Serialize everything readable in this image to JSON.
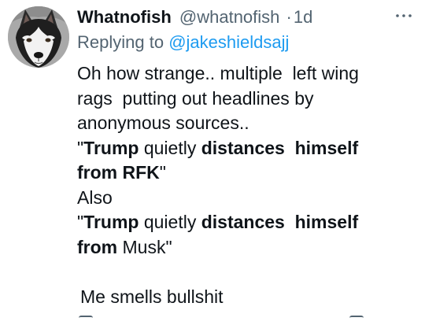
{
  "tweet": {
    "display_name": "Whatnofish",
    "handle": "@whatnofish",
    "separator": "·",
    "time": "1d",
    "more_icon": "more-horizontal-icon",
    "replying_prefix": "Replying to ",
    "replying_to": "@jakeshieldsajj",
    "lines": {
      "l1": "Oh how strange.. multiple  left wing",
      "l2": "rags  putting out headlines by",
      "l3": "anonymous sources..",
      "l4_q": "\"",
      "l4_b1": "Trump",
      "l4_t1": " quietly ",
      "l4_b2": "distances  himself",
      "l5_b": "from RFK",
      "l5_t": "\"",
      "l6": "Also",
      "l7_q": "\"",
      "l7_b1": "Trump",
      "l7_t1": " quietly ",
      "l7_b2": "distances  himself",
      "l8_b": "from",
      "l8_t": " Musk\"",
      "l10": "Me smells bullshit"
    }
  },
  "colors": {
    "text": "#0f1419",
    "secondary": "#536471",
    "link": "#1d9bf0"
  }
}
